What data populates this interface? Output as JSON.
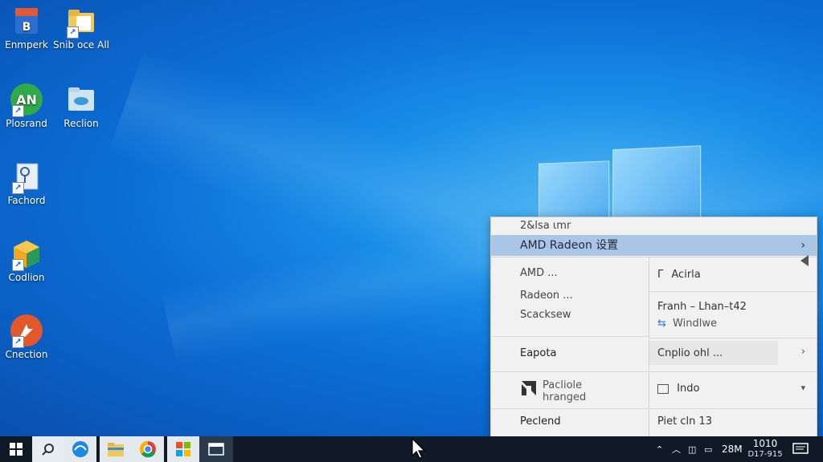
{
  "desktop": {
    "icons": [
      {
        "label": "Enmperk",
        "icon": "blue-book-icon"
      },
      {
        "label": "Snib oce All",
        "icon": "folder-shortcut-icon"
      },
      {
        "label": "Plosrand",
        "icon": "green-app-icon",
        "badge": "AN"
      },
      {
        "label": "Reclion",
        "icon": "cloud-folder-icon"
      },
      {
        "label": "Fachord",
        "icon": "key-document-icon"
      },
      {
        "label": "Codlion",
        "icon": "cube-icon"
      },
      {
        "label": "Cnection",
        "icon": "orange-circle-icon"
      }
    ]
  },
  "panel": {
    "header": "2&lsa ιmr",
    "highlight_label": "AMD Radeon 设置",
    "highlight_arrow": "›",
    "left": {
      "item1": "AMD ...",
      "item2": "Radeon ...",
      "item3": "Scacksew",
      "item4": "Eapota",
      "item5_line1": "Pacliole",
      "item5_line2": "hranged",
      "item6": "Peclend"
    },
    "right": {
      "item1": "Acirla",
      "item1_prefix": "Γ",
      "item2": "Franh – Lhan–t42",
      "item3": "Windlwe",
      "item4": "Cnplio ohl ...",
      "item4_arrow": "›",
      "item5": "Indo",
      "item5_arrow": "▾",
      "item6": "Piet cln 13"
    }
  },
  "taskbar": {
    "tray_label": "28M",
    "clock_time": "1010",
    "clock_date": "D17-915"
  }
}
